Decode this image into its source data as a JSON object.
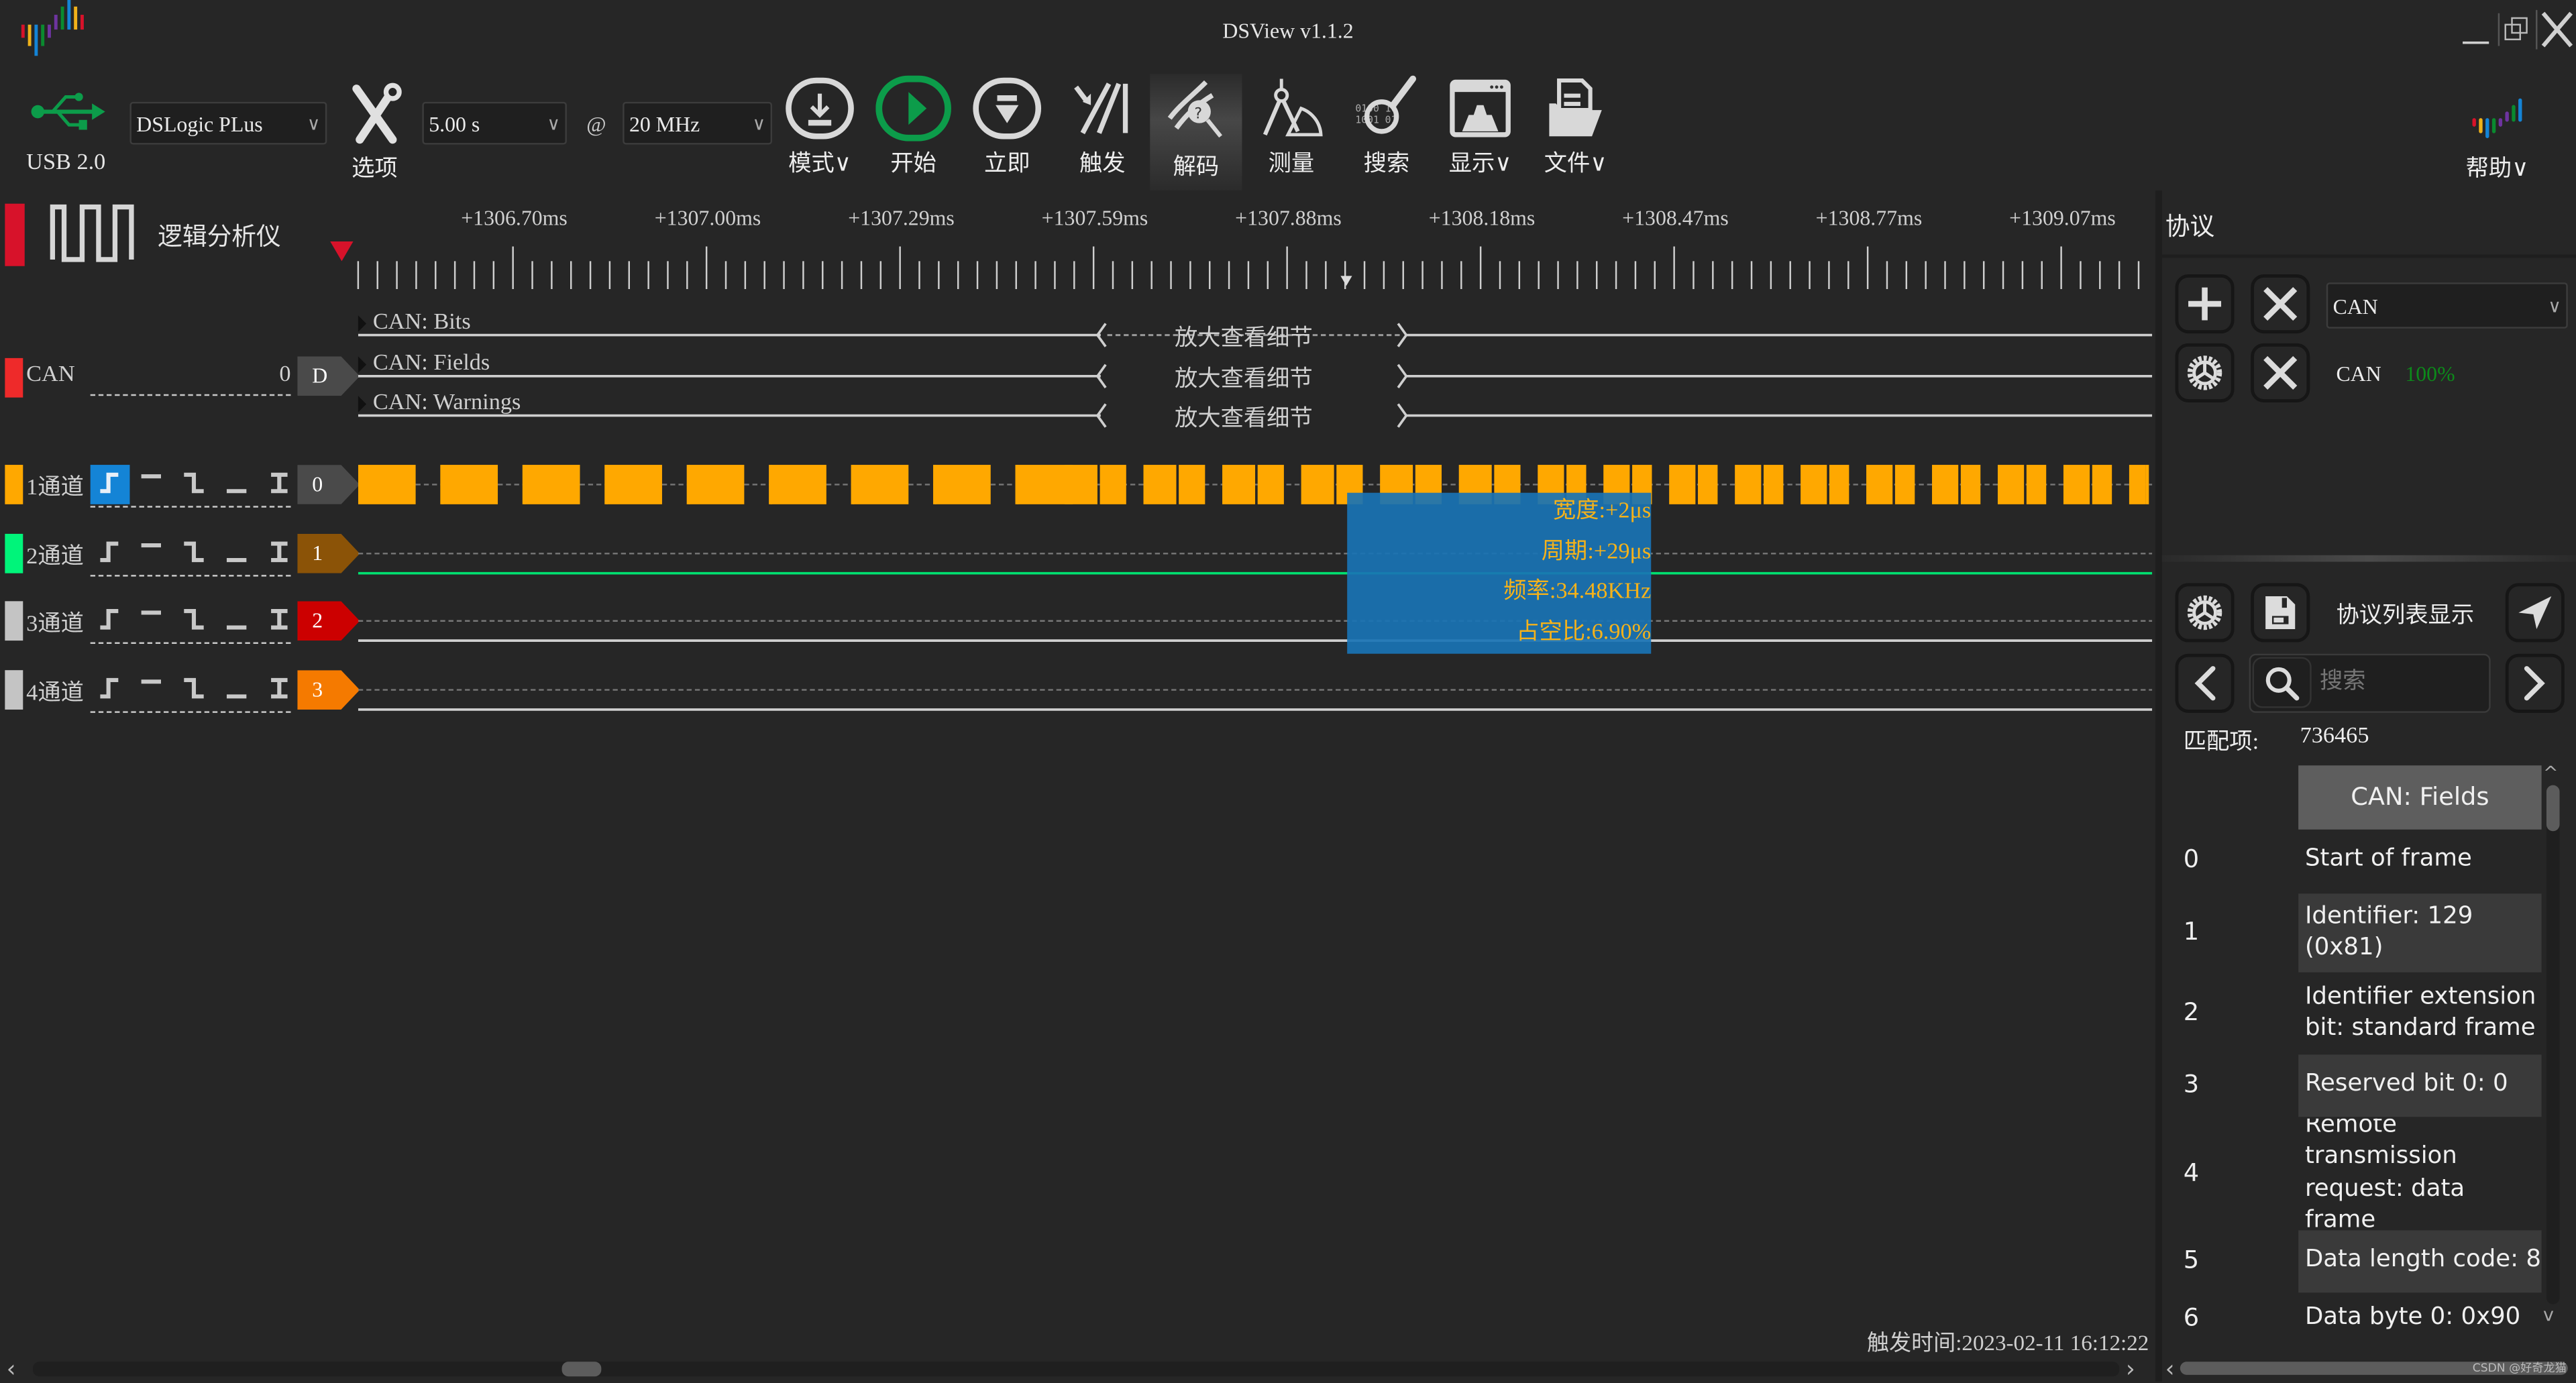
{
  "window": {
    "title": "DSView v1.1.2",
    "minimize": "_",
    "restore": "restore-icon",
    "close": "close-icon"
  },
  "toolbar": {
    "usb_label": "USB 2.0",
    "device": "DSLogic PLus",
    "options_label": "选项",
    "duration": "5.00 s",
    "at": "@",
    "samplerate": "20 MHz",
    "tools": [
      {
        "id": "mode",
        "label": "模式∨",
        "icon": "download-icon"
      },
      {
        "id": "start",
        "label": "开始",
        "icon": "play-icon"
      },
      {
        "id": "instant",
        "label": "立即",
        "icon": "instant-icon"
      },
      {
        "id": "trigger",
        "label": "触发",
        "icon": "trigger-icon"
      },
      {
        "id": "decode",
        "label": "解码",
        "icon": "decode-icon",
        "active": true
      },
      {
        "id": "measure",
        "label": "测量",
        "icon": "measure-icon"
      },
      {
        "id": "search",
        "label": "搜索",
        "icon": "search-binary-icon"
      },
      {
        "id": "display",
        "label": "显示∨",
        "icon": "display-icon"
      },
      {
        "id": "file",
        "label": "文件∨",
        "icon": "file-icon"
      }
    ],
    "help_label": "帮助∨"
  },
  "header": {
    "mode_name": "逻辑分析仪"
  },
  "ruler": {
    "labels": [
      "+1306.70ms",
      "+1307.00ms",
      "+1307.29ms",
      "+1307.59ms",
      "+1307.88ms",
      "+1308.18ms",
      "+1308.47ms",
      "+1308.77ms",
      "+1309.07ms"
    ]
  },
  "decoder": {
    "name": "CAN",
    "channel": "0",
    "tag": "D",
    "rows": [
      "CAN: Bits",
      "CAN: Fields",
      "CAN: Warnings"
    ],
    "zoom_hint": "放大查看细节"
  },
  "channels": [
    {
      "name": "1通道",
      "index": "0",
      "color": "#FFA800",
      "tag_color": "#4a4a4a",
      "trigger_selected": 0
    },
    {
      "name": "2通道",
      "index": "1",
      "color": "#00F47A",
      "tag_color": "#8B5307",
      "trigger_selected": -1
    },
    {
      "name": "3通道",
      "index": "2",
      "color": "#C4C4C4",
      "tag_color": "#CC0000",
      "trigger_selected": -1
    },
    {
      "name": "4通道",
      "index": "3",
      "color": "#C4C4C4",
      "tag_color": "#F57A00",
      "trigger_selected": -1
    }
  ],
  "measurement": {
    "width": "宽度:+2μs",
    "period": "周期:+29μs",
    "frequency": "频率:34.48KHz",
    "duty": "占空比:6.90%"
  },
  "status": {
    "trigger_time": "触发时间:2023-02-11 16:12:22"
  },
  "panel": {
    "title": "协议",
    "protocol_select": "CAN",
    "active_decoder": "CAN",
    "decode_progress": "100%",
    "list_title": "协议列表显示",
    "search_placeholder": "搜索",
    "match_label": "匹配项:",
    "match_count": "736465",
    "table_header": "CAN: Fields",
    "rows": [
      {
        "idx": "0",
        "text": "Start of frame"
      },
      {
        "idx": "1",
        "text": "Identifier: 129 (0x81)"
      },
      {
        "idx": "2",
        "text": "Identifier extension bit: standard frame"
      },
      {
        "idx": "3",
        "text": "Reserved bit 0: 0"
      },
      {
        "idx": "4",
        "text": "Remote transmission request: data frame"
      },
      {
        "idx": "5",
        "text": "Data length code: 8"
      },
      {
        "idx": "6",
        "text": "Data byte 0: 0x90"
      }
    ]
  },
  "watermark": "CSDN @好奇龙猫"
}
